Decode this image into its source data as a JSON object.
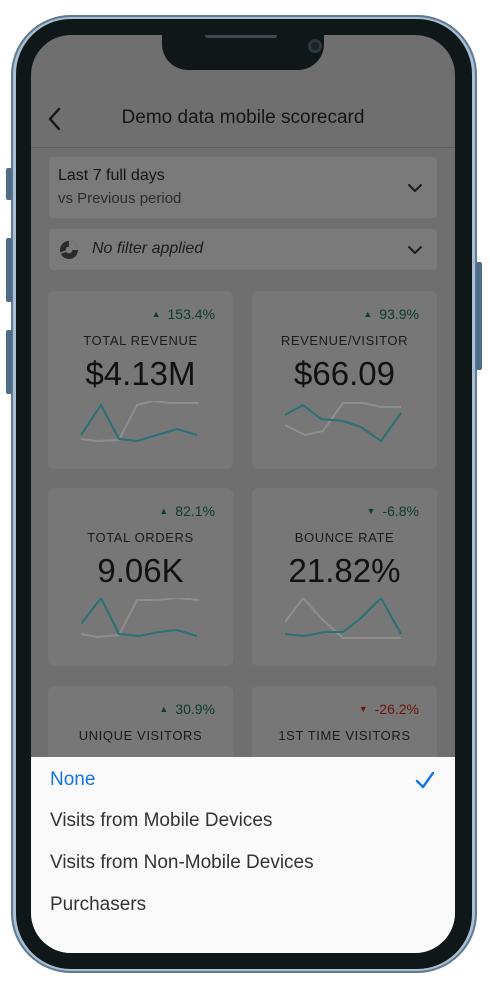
{
  "header": {
    "title": "Demo data mobile scorecard"
  },
  "date_range": {
    "primary": "Last 7 full days",
    "secondary": "vs Previous period"
  },
  "segment_filter": {
    "label": "No filter applied"
  },
  "metrics": [
    {
      "label": "TOTAL REVENUE",
      "value": "$4.13M",
      "delta": "153.4%",
      "delta_arrow": "▲",
      "direction": "up"
    },
    {
      "label": "REVENUE/VISITOR",
      "value": "$66.09",
      "delta": "93.9%",
      "delta_arrow": "▲",
      "direction": "up"
    },
    {
      "label": "TOTAL ORDERS",
      "value": "9.06K",
      "delta": "82.1%",
      "delta_arrow": "▲",
      "direction": "up"
    },
    {
      "label": "BOUNCE RATE",
      "value": "21.82%",
      "delta": "-6.8%",
      "delta_arrow": "▼",
      "direction": "down"
    },
    {
      "label": "UNIQUE VISITORS",
      "value": "",
      "delta": "30.9%",
      "delta_arrow": "▲",
      "direction": "up"
    },
    {
      "label": "1ST TIME VISITORS",
      "value": "",
      "delta": "-26.2%",
      "delta_arrow": "▼",
      "direction": "down"
    }
  ],
  "segment_sheet": {
    "options": [
      {
        "label": "None",
        "selected": true
      },
      {
        "label": "Visits from Mobile Devices",
        "selected": false
      },
      {
        "label": "Visits from Non-Mobile Devices",
        "selected": false
      },
      {
        "label": "Purchasers",
        "selected": false
      }
    ]
  },
  "colors": {
    "accent_blue": "#1473e6",
    "positive_green": "#0e3c27",
    "negative_red": "#6a1212",
    "sparkline_current": "#2a7177",
    "sparkline_previous": "#8e8e8e"
  },
  "icons": {
    "back": "chevron-left-icon",
    "dropdown": "chevron-down-icon",
    "segment": "segment-icon",
    "selected": "checkmark-icon"
  }
}
